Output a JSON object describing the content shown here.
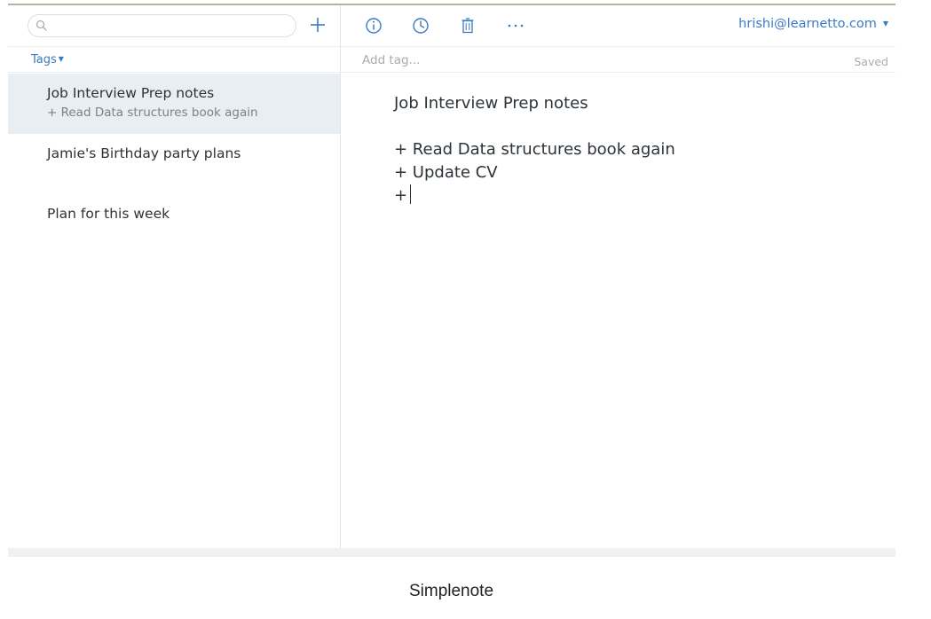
{
  "sidebar": {
    "search": {
      "placeholder": "",
      "value": ""
    },
    "add_icon": "plus-icon",
    "tags_label": "Tags",
    "notes": [
      {
        "title": "Job Interview Prep notes",
        "preview": "+ Read Data structures book again",
        "selected": true
      },
      {
        "title": "Jamie's Birthday party plans",
        "preview": "",
        "selected": false
      },
      {
        "title": "Plan for this week",
        "preview": "",
        "selected": false
      }
    ]
  },
  "toolbar": {
    "icons": [
      "info-icon",
      "history-icon",
      "trash-icon",
      "more-icon"
    ],
    "account": "hrishi@learnetto.com"
  },
  "editor": {
    "tag_placeholder": "Add tag...",
    "status": "Saved",
    "title": "Job Interview Prep notes",
    "lines": [
      "+ Read Data structures book again",
      "+ Update CV",
      "+"
    ]
  },
  "caption": "Simplenote",
  "colors": {
    "accent": "#3a7bc3",
    "selected_bg": "#e9eef3",
    "text": "#2c3338",
    "muted": "#7b8188"
  }
}
